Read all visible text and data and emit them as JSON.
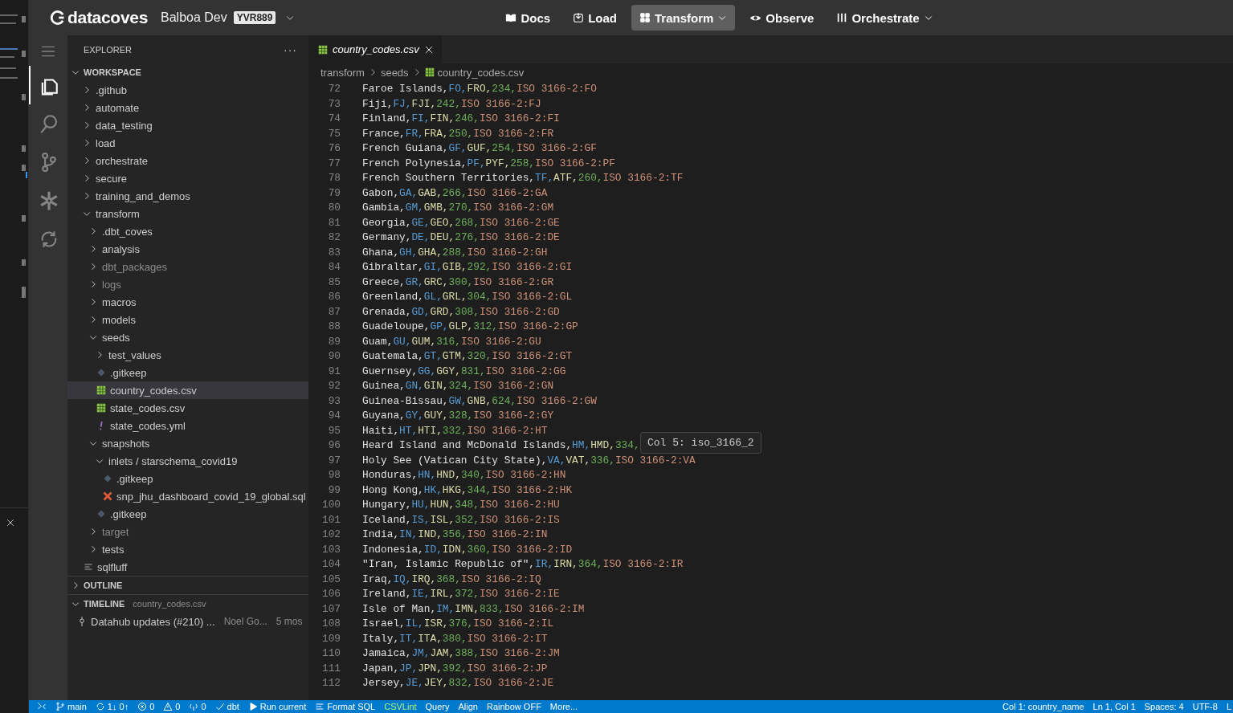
{
  "topbar": {
    "brand": "datacoves",
    "environment": "Balboa Dev",
    "badge": "YVR889",
    "nav": [
      {
        "label": "Docs",
        "kind": "book",
        "dropdown": false,
        "selected": false
      },
      {
        "label": "Load",
        "kind": "load",
        "dropdown": false,
        "selected": false
      },
      {
        "label": "Transform",
        "kind": "grid",
        "dropdown": true,
        "selected": true
      },
      {
        "label": "Observe",
        "kind": "eye",
        "dropdown": false,
        "selected": false
      },
      {
        "label": "Orchestrate",
        "kind": "bars",
        "dropdown": true,
        "selected": false
      }
    ]
  },
  "activity_bar": [
    {
      "kind": "files",
      "selected": true
    },
    {
      "kind": "search",
      "selected": false
    },
    {
      "kind": "branch",
      "selected": false
    },
    {
      "kind": "snowflake",
      "selected": false
    },
    {
      "kind": "sync",
      "selected": false
    }
  ],
  "sidebar": {
    "title": "EXPLORER",
    "more": "···",
    "workspace": "WORKSPACE",
    "tree": [
      {
        "label": ".github",
        "kind": "folder",
        "expanded": false,
        "dimmed": false,
        "selected": false
      },
      {
        "label": "automate",
        "kind": "folder",
        "expanded": false,
        "dimmed": false,
        "selected": false
      },
      {
        "label": "data_testing",
        "kind": "folder",
        "expanded": false,
        "dimmed": false,
        "selected": false
      },
      {
        "label": "load",
        "kind": "folder",
        "expanded": false,
        "dimmed": false,
        "selected": false
      },
      {
        "label": "orchestrate",
        "kind": "folder",
        "expanded": false,
        "dimmed": false,
        "selected": false
      },
      {
        "label": "secure",
        "kind": "folder",
        "expanded": false,
        "dimmed": false,
        "selected": false
      },
      {
        "label": "training_and_demos",
        "kind": "folder",
        "expanded": false,
        "dimmed": false,
        "selected": false
      },
      {
        "label": "transform",
        "kind": "folder",
        "expanded": true,
        "dimmed": false,
        "selected": false,
        "children": [
          {
            "label": ".dbt_coves",
            "kind": "folder",
            "expanded": false,
            "dimmed": false,
            "selected": false
          },
          {
            "label": "analysis",
            "kind": "folder",
            "expanded": false,
            "dimmed": false,
            "selected": false
          },
          {
            "label": "dbt_packages",
            "kind": "folder",
            "expanded": false,
            "dimmed": true,
            "selected": false
          },
          {
            "label": "logs",
            "kind": "folder",
            "expanded": false,
            "dimmed": true,
            "selected": false
          },
          {
            "label": "macros",
            "kind": "folder",
            "expanded": false,
            "dimmed": false,
            "selected": false
          },
          {
            "label": "models",
            "kind": "folder",
            "expanded": false,
            "dimmed": false,
            "selected": false
          },
          {
            "label": "seeds",
            "kind": "folder",
            "expanded": true,
            "dimmed": false,
            "selected": false,
            "children": [
              {
                "label": "test_values",
                "kind": "folder",
                "expanded": false,
                "dimmed": false,
                "selected": false
              },
              {
                "label": ".gitkeep",
                "kind": "gitkeep",
                "dimmed": false,
                "selected": false
              },
              {
                "label": "country_codes.csv",
                "kind": "csv",
                "dimmed": false,
                "selected": true
              },
              {
                "label": "state_codes.csv",
                "kind": "csv",
                "dimmed": false,
                "selected": false
              },
              {
                "label": "state_codes.yml",
                "kind": "yml",
                "dimmed": false,
                "selected": false
              }
            ]
          },
          {
            "label": "snapshots",
            "kind": "folder",
            "expanded": true,
            "dimmed": false,
            "selected": false,
            "children": [
              {
                "label": "inlets / starschema_covid19",
                "kind": "folder",
                "expanded": true,
                "dimmed": false,
                "selected": false,
                "children": [
                  {
                    "label": ".gitkeep",
                    "kind": "gitkeep",
                    "dimmed": false,
                    "selected": false
                  },
                  {
                    "label": "snp_jhu_dashboard_covid_19_global.sql",
                    "kind": "sql",
                    "dimmed": false,
                    "selected": false
                  }
                ]
              },
              {
                "label": ".gitkeep",
                "kind": "gitkeep",
                "dimmed": false,
                "selected": false
              }
            ]
          },
          {
            "label": "target",
            "kind": "folder",
            "expanded": false,
            "dimmed": true,
            "selected": false
          },
          {
            "label": "tests",
            "kind": "folder",
            "expanded": false,
            "dimmed": false,
            "selected": false
          }
        ]
      },
      {
        "label": "sqlfluff",
        "kind": "lines",
        "dimmed": false,
        "selected": false
      }
    ],
    "outline": {
      "title": "OUTLINE",
      "expanded": false
    },
    "timeline": {
      "title": "TIMELINE",
      "expanded": true,
      "file": "country_codes.csv",
      "entries": [
        {
          "message": "Datahub updates (#210) ...",
          "author": "Noel Go...",
          "age": "5 mos"
        }
      ]
    }
  },
  "editor": {
    "tab": {
      "label": "country_codes.csv",
      "selected": true
    },
    "breadcrumb": [
      "transform",
      "seeds",
      "country_codes.csv"
    ],
    "lines": [
      {
        "n": "72",
        "cells": [
          "Faroe Islands,",
          "FO,",
          "FRO,",
          "234,",
          "ISO 3166-2:FO"
        ]
      },
      {
        "n": "73",
        "cells": [
          "Fiji,",
          "FJ,",
          "FJI,",
          "242,",
          "ISO 3166-2:FJ"
        ]
      },
      {
        "n": "74",
        "cells": [
          "Finland,",
          "FI,",
          "FIN,",
          "246,",
          "ISO 3166-2:FI"
        ]
      },
      {
        "n": "75",
        "cells": [
          "France,",
          "FR,",
          "FRA,",
          "250,",
          "ISO 3166-2:FR"
        ]
      },
      {
        "n": "76",
        "cells": [
          "French Guiana,",
          "GF,",
          "GUF,",
          "254,",
          "ISO 3166-2:GF"
        ]
      },
      {
        "n": "77",
        "cells": [
          "French Polynesia,",
          "PF,",
          "PYF,",
          "258,",
          "ISO 3166-2:PF"
        ]
      },
      {
        "n": "78",
        "cells": [
          "French Southern Territories,",
          "TF,",
          "ATF,",
          "260,",
          "ISO 3166-2:TF"
        ]
      },
      {
        "n": "79",
        "cells": [
          "Gabon,",
          "GA,",
          "GAB,",
          "266,",
          "ISO 3166-2:GA"
        ]
      },
      {
        "n": "80",
        "cells": [
          "Gambia,",
          "GM,",
          "GMB,",
          "270,",
          "ISO 3166-2:GM"
        ]
      },
      {
        "n": "81",
        "cells": [
          "Georgia,",
          "GE,",
          "GEO,",
          "268,",
          "ISO 3166-2:GE"
        ]
      },
      {
        "n": "82",
        "cells": [
          "Germany,",
          "DE,",
          "DEU,",
          "276,",
          "ISO 3166-2:DE"
        ]
      },
      {
        "n": "83",
        "cells": [
          "Ghana,",
          "GH,",
          "GHA,",
          "288,",
          "ISO 3166-2:GH"
        ]
      },
      {
        "n": "84",
        "cells": [
          "Gibraltar,",
          "GI,",
          "GIB,",
          "292,",
          "ISO 3166-2:GI"
        ]
      },
      {
        "n": "85",
        "cells": [
          "Greece,",
          "GR,",
          "GRC,",
          "300,",
          "ISO 3166-2:GR"
        ]
      },
      {
        "n": "86",
        "cells": [
          "Greenland,",
          "GL,",
          "GRL,",
          "304,",
          "ISO 3166-2:GL"
        ]
      },
      {
        "n": "87",
        "cells": [
          "Grenada,",
          "GD,",
          "GRD,",
          "308,",
          "ISO 3166-2:GD"
        ]
      },
      {
        "n": "88",
        "cells": [
          "Guadeloupe,",
          "GP,",
          "GLP,",
          "312,",
          "ISO 3166-2:GP"
        ]
      },
      {
        "n": "89",
        "cells": [
          "Guam,",
          "GU,",
          "GUM,",
          "316,",
          "ISO 3166-2:GU"
        ]
      },
      {
        "n": "90",
        "cells": [
          "Guatemala,",
          "GT,",
          "GTM,",
          "320,",
          "ISO 3166-2:GT"
        ]
      },
      {
        "n": "91",
        "cells": [
          "Guernsey,",
          "GG,",
          "GGY,",
          "831,",
          "ISO 3166-2:GG"
        ]
      },
      {
        "n": "92",
        "cells": [
          "Guinea,",
          "GN,",
          "GIN,",
          "324,",
          "ISO 3166-2:GN"
        ]
      },
      {
        "n": "93",
        "cells": [
          "Guinea-Bissau,",
          "GW,",
          "GNB,",
          "624,",
          "ISO 3166-2:GW"
        ]
      },
      {
        "n": "94",
        "cells": [
          "Guyana,",
          "GY,",
          "GUY,",
          "328,",
          "ISO 3166-2:GY"
        ]
      },
      {
        "n": "95",
        "cells": [
          "Haiti,",
          "HT,",
          "HTI,",
          "332,",
          "ISO 3166-2:HT"
        ]
      },
      {
        "n": "96",
        "cells": [
          "Heard Island and McDonald Islands,",
          "HM,",
          "HMD,",
          "334,"
        ]
      },
      {
        "n": "97",
        "cells": [
          "Holy See (Vatican City State),",
          "VA,",
          "VAT,",
          "336,",
          "ISO 3166-2:VA"
        ]
      },
      {
        "n": "98",
        "cells": [
          "Honduras,",
          "HN,",
          "HND,",
          "340,",
          "ISO 3166-2:HN"
        ]
      },
      {
        "n": "99",
        "cells": [
          "Hong Kong,",
          "HK,",
          "HKG,",
          "344,",
          "ISO 3166-2:HK"
        ]
      },
      {
        "n": "100",
        "cells": [
          "Hungary,",
          "HU,",
          "HUN,",
          "348,",
          "ISO 3166-2:HU"
        ]
      },
      {
        "n": "101",
        "cells": [
          "Iceland,",
          "IS,",
          "ISL,",
          "352,",
          "ISO 3166-2:IS"
        ]
      },
      {
        "n": "102",
        "cells": [
          "India,",
          "IN,",
          "IND,",
          "356,",
          "ISO 3166-2:IN"
        ]
      },
      {
        "n": "103",
        "cells": [
          "Indonesia,",
          "ID,",
          "IDN,",
          "360,",
          "ISO 3166-2:ID"
        ]
      },
      {
        "n": "104",
        "cells": [
          "\"Iran, Islamic Republic of\",",
          "IR,",
          "IRN,",
          "364,",
          "ISO 3166-2:IR"
        ]
      },
      {
        "n": "105",
        "cells": [
          "Iraq,",
          "IQ,",
          "IRQ,",
          "368,",
          "ISO 3166-2:IQ"
        ]
      },
      {
        "n": "106",
        "cells": [
          "Ireland,",
          "IE,",
          "IRL,",
          "372,",
          "ISO 3166-2:IE"
        ]
      },
      {
        "n": "107",
        "cells": [
          "Isle of Man,",
          "IM,",
          "IMN,",
          "833,",
          "ISO 3166-2:IM"
        ]
      },
      {
        "n": "108",
        "cells": [
          "Israel,",
          "IL,",
          "ISR,",
          "376,",
          "ISO 3166-2:IL"
        ]
      },
      {
        "n": "109",
        "cells": [
          "Italy,",
          "IT,",
          "ITA,",
          "380,",
          "ISO 3166-2:IT"
        ]
      },
      {
        "n": "110",
        "cells": [
          "Jamaica,",
          "JM,",
          "JAM,",
          "388,",
          "ISO 3166-2:JM"
        ]
      },
      {
        "n": "111",
        "cells": [
          "Japan,",
          "JP,",
          "JPN,",
          "392,",
          "ISO 3166-2:JP"
        ]
      },
      {
        "n": "112",
        "cells": [
          "Jersey,",
          "JE,",
          "JEY,",
          "832,",
          "ISO 3166-2:JE"
        ]
      }
    ],
    "tooltip": {
      "text": "Col 5: iso_3166_2"
    }
  },
  "status_bar": {
    "left": [
      {
        "kind": "remote"
      },
      {
        "kind": "branch",
        "text": "main"
      },
      {
        "kind": "sync",
        "text": "1↓ 0↑"
      },
      {
        "kind": "error",
        "text": "0"
      },
      {
        "kind": "warning",
        "text": "0"
      },
      {
        "kind": "ports",
        "text": "0"
      },
      {
        "kind": "check",
        "text": "dbt"
      },
      {
        "kind": "play",
        "text": "Run current"
      },
      {
        "kind": "lines",
        "text": "Format SQL"
      },
      {
        "kind": "text",
        "text": "CSVLint",
        "highlight": true
      },
      {
        "kind": "text",
        "text": "Query",
        "highlight": false
      },
      {
        "kind": "text",
        "text": "Align",
        "highlight": false
      },
      {
        "kind": "text",
        "text": "Rainbow OFF",
        "highlight": false
      },
      {
        "kind": "text",
        "text": "More...",
        "highlight": false
      }
    ],
    "right": [
      {
        "text": "Col 1: country_name"
      },
      {
        "text": "Ln 1, Col 1"
      },
      {
        "text": "Spaces: 4"
      },
      {
        "text": "UTF-8"
      },
      {
        "text": "L"
      }
    ]
  }
}
